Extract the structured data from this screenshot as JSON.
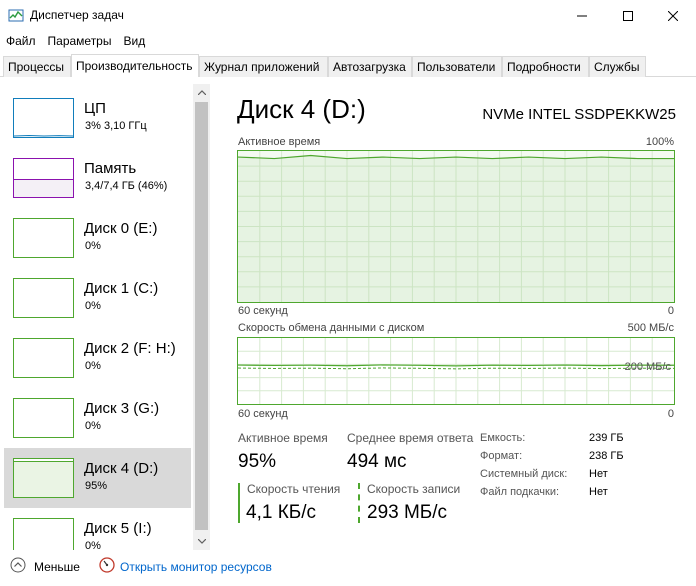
{
  "window": {
    "title": "Диспетчер задач",
    "icon": "task-manager-icon"
  },
  "menu": [
    {
      "label": "Файл"
    },
    {
      "label": "Параметры"
    },
    {
      "label": "Вид"
    }
  ],
  "tabs": [
    {
      "label": "Процессы",
      "active": false
    },
    {
      "label": "Производительность",
      "active": true
    },
    {
      "label": "Журнал приложений",
      "active": false
    },
    {
      "label": "Автозагрузка",
      "active": false
    },
    {
      "label": "Пользователи",
      "active": false
    },
    {
      "label": "Подробности",
      "active": false
    },
    {
      "label": "Службы",
      "active": false
    }
  ],
  "sidebar": {
    "items": [
      {
        "name": "ЦП",
        "sub": "3%  3,10 ГГц",
        "color": "#117dbb",
        "fill_fraction": 0.03
      },
      {
        "name": "Память",
        "sub": "3,4/7,4 ГБ (46%)",
        "color": "#8b12ae",
        "fill_fraction": 0.46
      },
      {
        "name": "Диск 0 (E:)",
        "sub": "0%",
        "color": "#4ea72e",
        "fill_fraction": 0
      },
      {
        "name": "Диск 1 (C:)",
        "sub": "0%",
        "color": "#4ea72e",
        "fill_fraction": 0
      },
      {
        "name": "Диск 2 (F: H:)",
        "sub": "0%",
        "color": "#4ea72e",
        "fill_fraction": 0
      },
      {
        "name": "Диск 3 (G:)",
        "sub": "0%",
        "color": "#4ea72e",
        "fill_fraction": 0
      },
      {
        "name": "Диск 4 (D:)",
        "sub": "95%",
        "color": "#4ea72e",
        "fill_fraction": 0.95,
        "selected": true
      },
      {
        "name": "Диск 5 (I:)",
        "sub": "0%",
        "color": "#4ea72e",
        "fill_fraction": 0
      }
    ]
  },
  "main": {
    "title": "Диск 4 (D:)",
    "model": "NVMe INTEL SSDPEKKW25",
    "active_chart": {
      "label": "Активное время",
      "max_label": "100%",
      "time_label": "60 секунд",
      "min_label": "0"
    },
    "transfer_chart": {
      "label": "Скорость обмена данными с диском",
      "max_label": "500 МБ/с",
      "mid_label": "200 МБ/с",
      "time_label": "60 секунд",
      "min_label": "0"
    },
    "stats": {
      "active_time_label": "Активное время",
      "active_time_value": "95%",
      "avg_response_label": "Среднее время ответа",
      "avg_response_value": "494 мс",
      "read_speed_label": "Скорость чтения",
      "read_speed_value": "4,1 КБ/с",
      "write_speed_label": "Скорость записи",
      "write_speed_value": "293 МБ/с"
    },
    "properties": [
      {
        "label": "Емкость:",
        "value": "239 ГБ"
      },
      {
        "label": "Формат:",
        "value": "238 ГБ"
      },
      {
        "label": "Системный диск:",
        "value": "Нет"
      },
      {
        "label": "Файл подкачки:",
        "value": "Нет"
      }
    ]
  },
  "footer": {
    "fewer_label": "Меньше",
    "resmon_label": "Открыть монитор ресурсов"
  },
  "chart_data": [
    {
      "type": "line",
      "title": "Активное время",
      "xlabel": "60 секунд",
      "ylim": [
        0,
        100
      ],
      "x": [
        60,
        55,
        50,
        45,
        40,
        35,
        30,
        25,
        20,
        15,
        10,
        5,
        0
      ],
      "series": [
        {
          "values": [
            96,
            95,
            97,
            95,
            96,
            95,
            96,
            95,
            96,
            95,
            96,
            95,
            95
          ]
        }
      ]
    },
    {
      "type": "line",
      "title": "Скорость обмена данными с диском",
      "xlabel": "60 секунд",
      "ylim": [
        0,
        500
      ],
      "x": [
        60,
        55,
        50,
        45,
        40,
        35,
        30,
        25,
        20,
        15,
        10,
        5,
        0
      ],
      "series": [
        {
          "values": [
            295,
            292,
            294,
            290,
            296,
            293,
            289,
            294,
            292,
            295,
            291,
            294,
            293
          ]
        }
      ]
    }
  ]
}
